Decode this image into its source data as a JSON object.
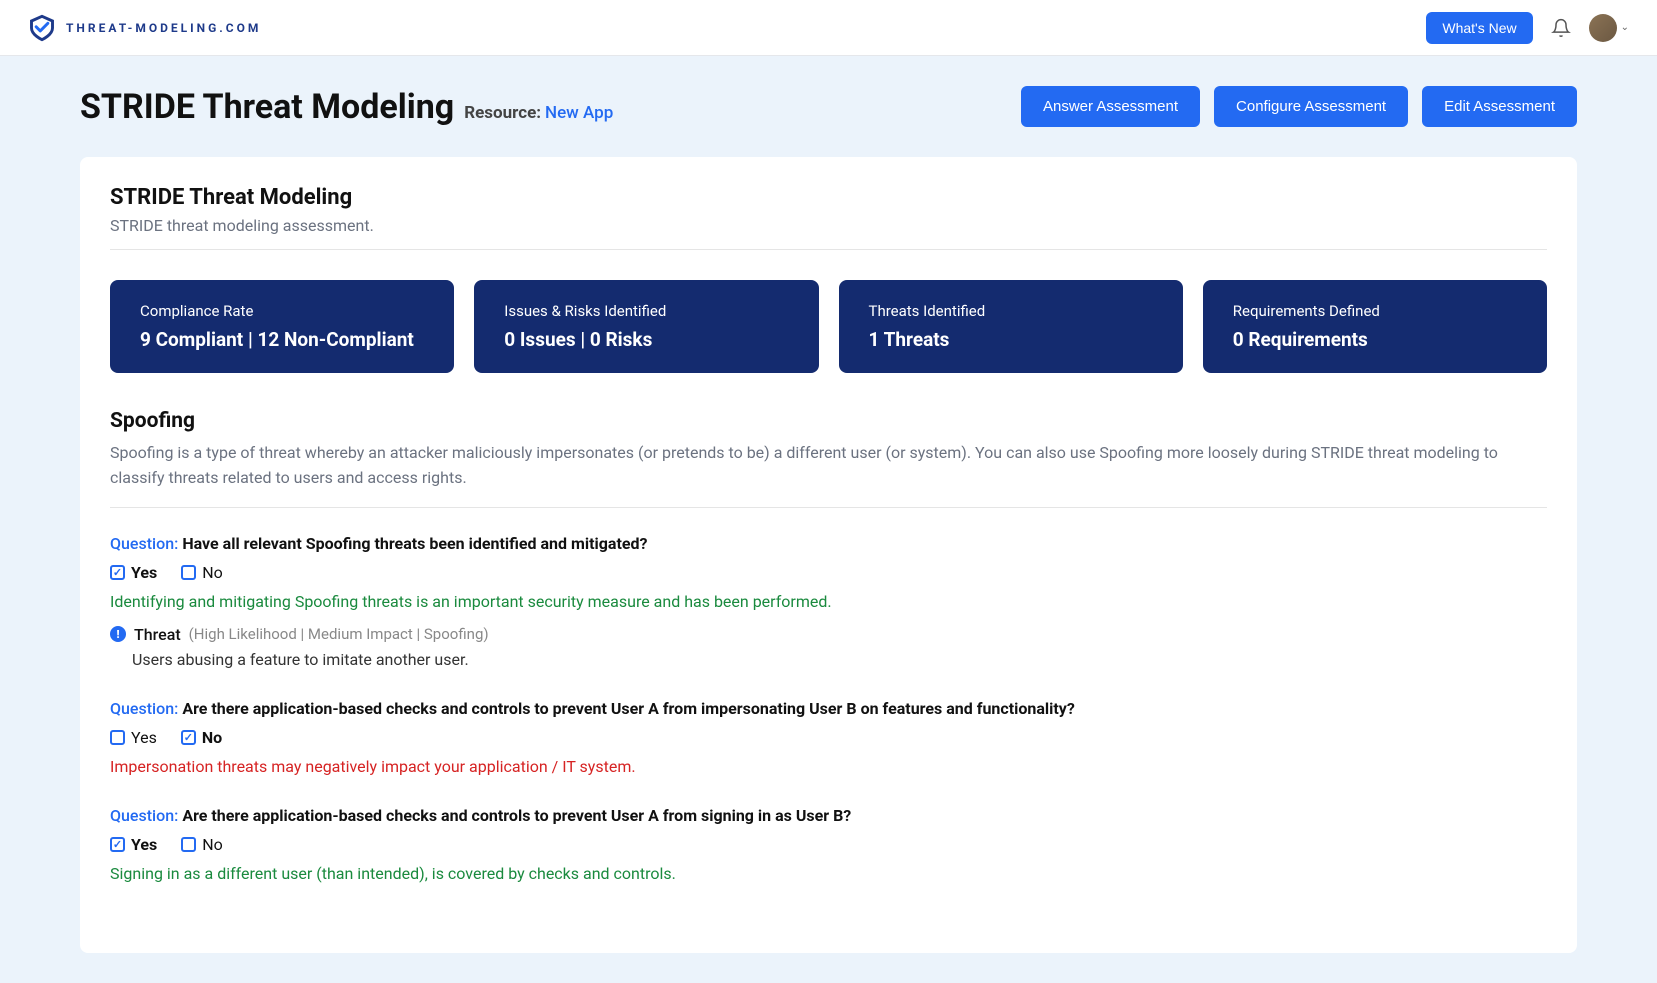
{
  "brand": {
    "text": "THREAT-MODELING.COM"
  },
  "topbar": {
    "whats_new": "What's New"
  },
  "header": {
    "title": "STRIDE Threat Modeling",
    "resource_prefix": "Resource:",
    "resource_name": "New App",
    "actions": {
      "answer": "Answer Assessment",
      "configure": "Configure Assessment",
      "edit": "Edit Assessment"
    }
  },
  "card": {
    "title": "STRIDE Threat Modeling",
    "subtitle": "STRIDE threat modeling assessment."
  },
  "stats": [
    {
      "label": "Compliance Rate",
      "value": "9 Compliant | 12 Non-Compliant"
    },
    {
      "label": "Issues & Risks Identified",
      "value": "0 Issues | 0 Risks"
    },
    {
      "label": "Threats Identified",
      "value": "1 Threats"
    },
    {
      "label": "Requirements Defined",
      "value": "0 Requirements"
    }
  ],
  "section": {
    "title": "Spoofing",
    "desc": "Spoofing is a type of threat whereby an attacker maliciously impersonates (or pretends to be) a different user (or system). You can also use Spoofing more loosely during STRIDE threat modeling to classify threats related to users and access rights."
  },
  "questions": [
    {
      "prefix": "Question:",
      "text": "Have all relevant Spoofing threats been identified and mitigated?",
      "yes": "Yes",
      "no": "No",
      "selected": "yes",
      "feedback": "Identifying and mitigating Spoofing threats is an important security measure and has been performed.",
      "feedback_type": "ok",
      "threat": {
        "label": "Threat",
        "meta": "(High Likelihood | Medium Impact | Spoofing)",
        "desc": "Users abusing a feature to imitate another user."
      }
    },
    {
      "prefix": "Question:",
      "text": "Are there application-based checks and controls to prevent User A from impersonating User B on features and functionality?",
      "yes": "Yes",
      "no": "No",
      "selected": "no",
      "feedback": "Impersonation threats may negatively impact your application / IT system.",
      "feedback_type": "bad"
    },
    {
      "prefix": "Question:",
      "text": "Are there application-based checks and controls to prevent User A from signing in as User B?",
      "yes": "Yes",
      "no": "No",
      "selected": "yes",
      "feedback": "Signing in as a different user (than intended), is covered by checks and controls.",
      "feedback_type": "ok"
    }
  ]
}
